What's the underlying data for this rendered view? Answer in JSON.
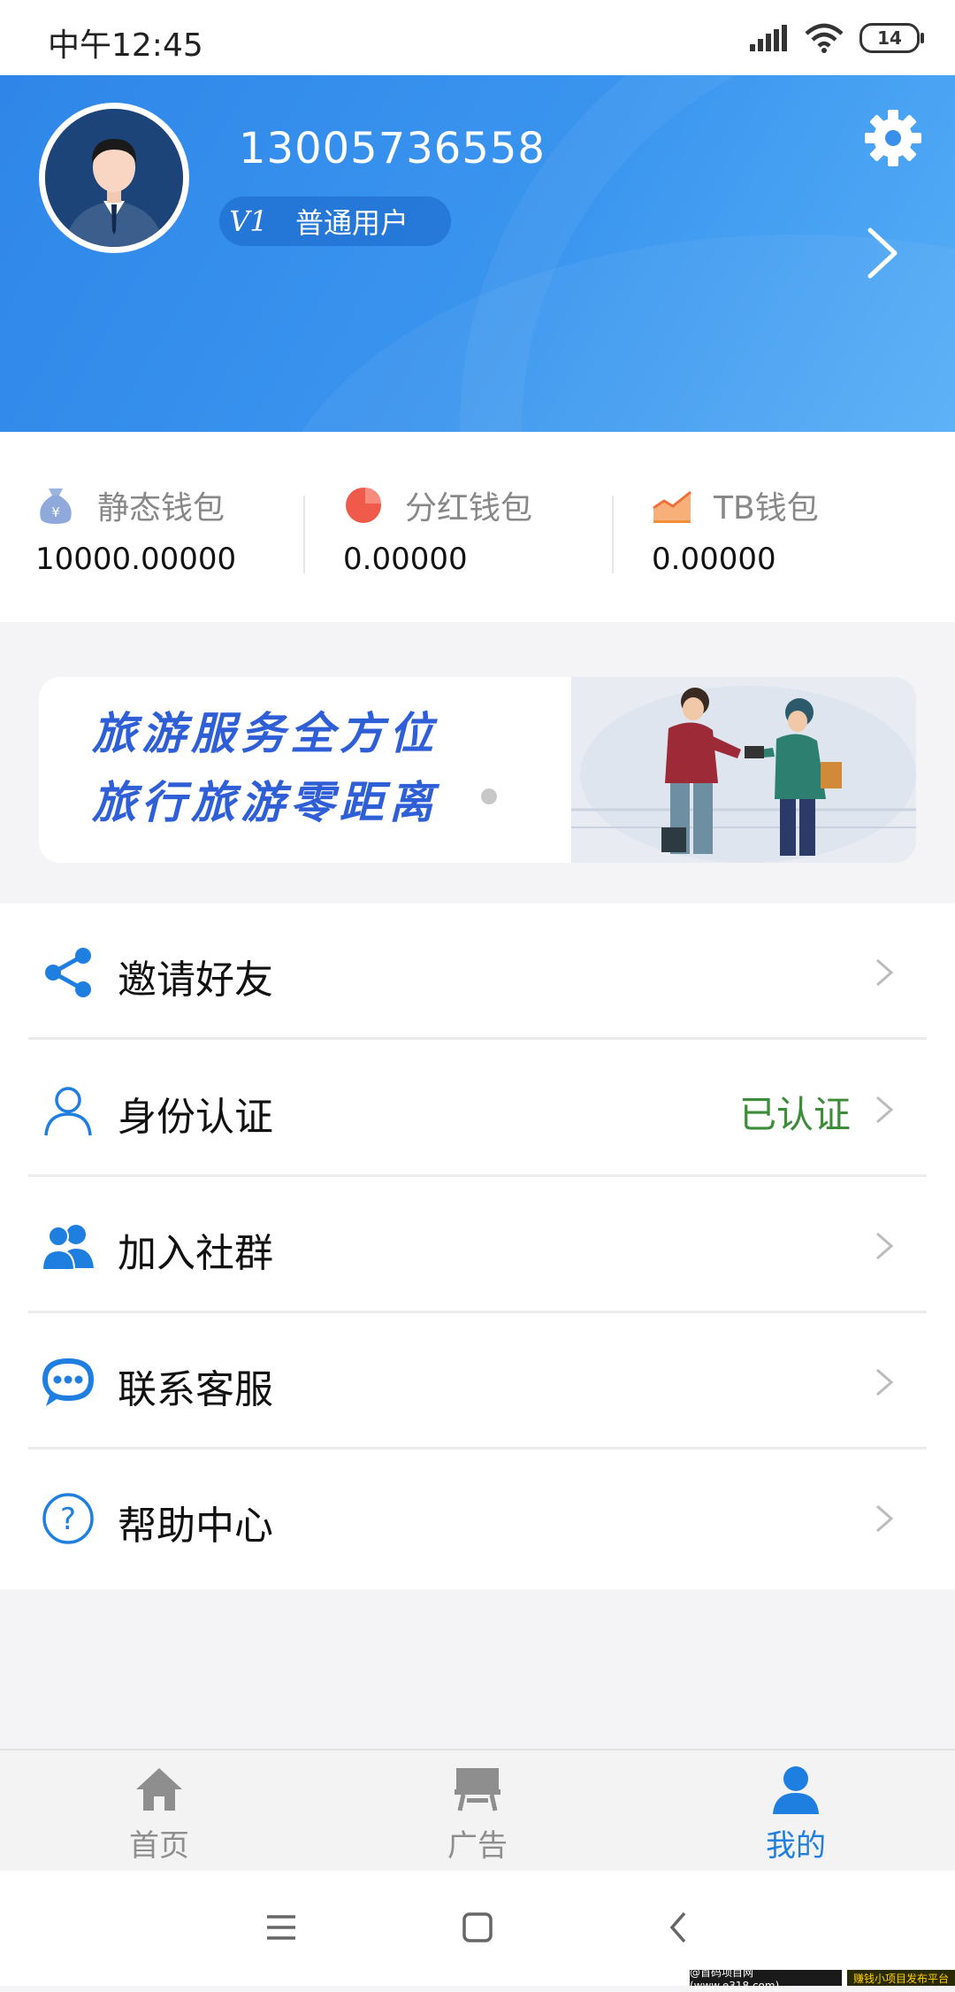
{
  "status_bar": {
    "time": "中午12:45",
    "battery": "14"
  },
  "profile": {
    "phone": "13005736558",
    "level_badge": "V1",
    "level_name": "普通用户"
  },
  "wallets": [
    {
      "title": "静态钱包",
      "value": "10000.00000",
      "icon": "money-bag-icon"
    },
    {
      "title": "分红钱包",
      "value": "0.00000",
      "icon": "pie-chart-icon"
    },
    {
      "title": "TB钱包",
      "value": "0.00000",
      "icon": "area-chart-icon"
    }
  ],
  "banner": {
    "line1": "旅游服务全方位",
    "line2": "旅行旅游零距离",
    "active_index": 0,
    "count": 2
  },
  "menu": [
    {
      "label": "邀请好友",
      "icon": "share-icon",
      "value": ""
    },
    {
      "label": "身份认证",
      "icon": "user-outline-icon",
      "value": "已认证"
    },
    {
      "label": "加入社群",
      "icon": "group-icon",
      "value": ""
    },
    {
      "label": "联系客服",
      "icon": "chat-bubble-icon",
      "value": ""
    },
    {
      "label": "帮助中心",
      "icon": "help-circle-icon",
      "value": ""
    }
  ],
  "nav": [
    {
      "label": "首页",
      "icon": "home-icon",
      "active": false
    },
    {
      "label": "广告",
      "icon": "billboard-icon",
      "active": false
    },
    {
      "label": "我的",
      "icon": "person-icon",
      "active": true
    }
  ],
  "watermark": {
    "left": "@首码项目网(www.e318.com)",
    "right": "赚钱小项目发布平台"
  },
  "colors": {
    "accent": "#1f7fe0",
    "header_start": "#2f86e8",
    "header_end": "#56aef6",
    "verified": "#3c8c3a",
    "inactive_nav": "#8e8e8e"
  }
}
